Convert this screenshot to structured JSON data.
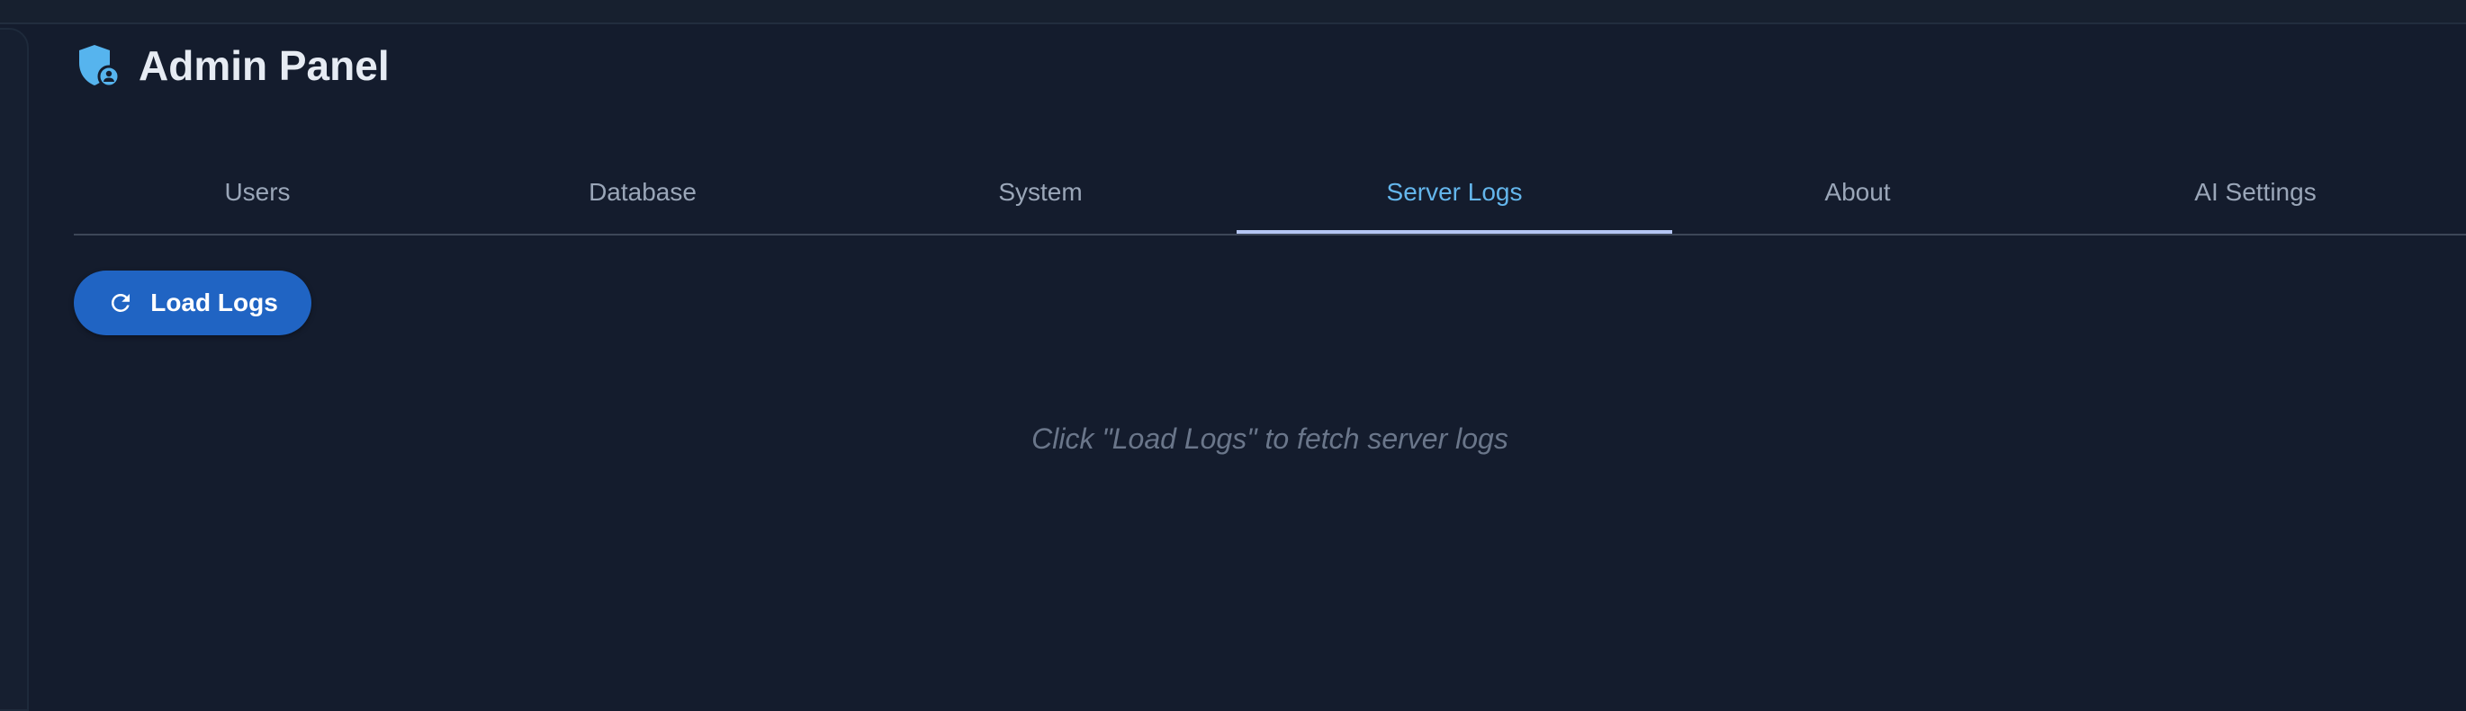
{
  "header": {
    "title": "Admin Panel",
    "icon": "admin-shield-icon"
  },
  "tabs": [
    {
      "label": "Users",
      "active": false
    },
    {
      "label": "Database",
      "active": false
    },
    {
      "label": "System",
      "active": false
    },
    {
      "label": "Server Logs",
      "active": true
    },
    {
      "label": "About",
      "active": false
    },
    {
      "label": "AI Settings",
      "active": false
    }
  ],
  "actions": {
    "load_logs_label": "Load Logs",
    "load_logs_icon": "refresh-icon"
  },
  "logs": {
    "empty_message": "Click \"Load Logs\" to fetch server logs"
  },
  "colors": {
    "background": "#141c2d",
    "accent": "#64b6ec",
    "primary_button": "#2064c3",
    "tab_indicator": "#b5c6f4"
  }
}
